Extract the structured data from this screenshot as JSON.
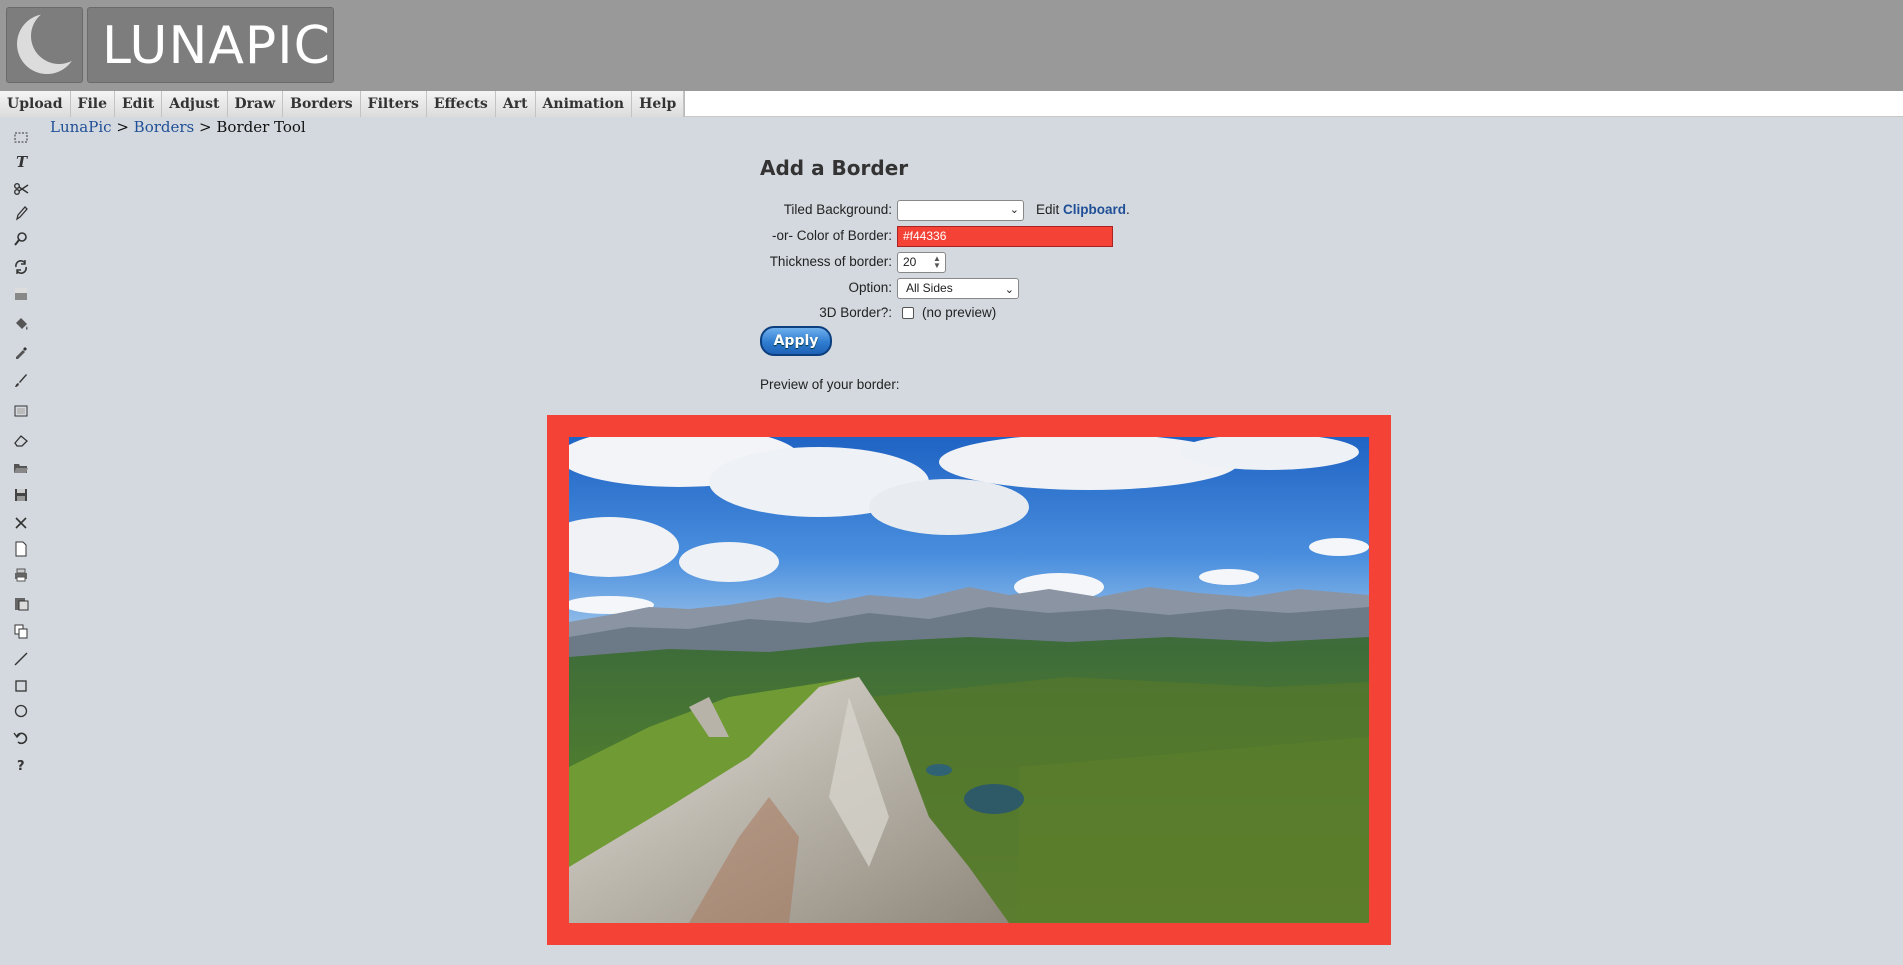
{
  "app": {
    "logo_text": "LUNAPIC"
  },
  "menu": [
    "Upload",
    "File",
    "Edit",
    "Adjust",
    "Draw",
    "Borders",
    "Filters",
    "Effects",
    "Art",
    "Animation",
    "Help"
  ],
  "toolbar": [
    {
      "name": "select-icon",
      "glyph": "select"
    },
    {
      "name": "text-icon",
      "glyph": "text"
    },
    {
      "name": "scissors-icon",
      "glyph": "scissors"
    },
    {
      "name": "pencil-icon",
      "glyph": "pencil"
    },
    {
      "name": "zoom-icon",
      "glyph": "zoom"
    },
    {
      "name": "rotate-icon",
      "glyph": "rotate"
    },
    {
      "name": "gradient-icon",
      "glyph": "gradient"
    },
    {
      "name": "paint-bucket-icon",
      "glyph": "bucket"
    },
    {
      "name": "eyedropper-icon",
      "glyph": "eyedropper"
    },
    {
      "name": "brush-icon",
      "glyph": "brush"
    },
    {
      "name": "crop-icon",
      "glyph": "crop"
    },
    {
      "name": "eraser-icon",
      "glyph": "eraser"
    },
    {
      "name": "open-folder-icon",
      "glyph": "folder"
    },
    {
      "name": "save-icon",
      "glyph": "save"
    },
    {
      "name": "close-icon",
      "glyph": "close"
    },
    {
      "name": "new-file-icon",
      "glyph": "file"
    },
    {
      "name": "print-icon",
      "glyph": "print"
    },
    {
      "name": "paste-icon",
      "glyph": "paste"
    },
    {
      "name": "copy-icon",
      "glyph": "copy"
    },
    {
      "name": "line-icon",
      "glyph": "line"
    },
    {
      "name": "rectangle-icon",
      "glyph": "rect"
    },
    {
      "name": "circle-icon",
      "glyph": "circle"
    },
    {
      "name": "undo-icon",
      "glyph": "undo"
    },
    {
      "name": "help-icon",
      "glyph": "help"
    }
  ],
  "breadcrumb": {
    "root": "LunaPic",
    "section": "Borders",
    "current": "Border Tool",
    "sep": ">"
  },
  "form": {
    "title": "Add a Border",
    "tiled_background_label": "Tiled Background:",
    "tiled_background_value": "",
    "edit_prefix": "Edit",
    "clipboard_link": "Clipboard",
    "edit_suffix": ".",
    "color_label": "-or- Color of Border:",
    "color_value": "#f44336",
    "thickness_label": "Thickness of border:",
    "thickness_value": "20",
    "option_label": "Option:",
    "option_value": "All Sides",
    "border3d_label": "3D Border?:",
    "border3d_checked": false,
    "no_preview": "(no preview)",
    "apply_label": "Apply",
    "preview_label": "Preview of your border:"
  },
  "colors": {
    "border": "#f44336",
    "link": "#1f4f96",
    "header_bg": "#999999",
    "page_bg": "#d4d9df"
  },
  "preview": {
    "image": "mountain-landscape",
    "border_color": "#f44336",
    "thickness": 20
  }
}
